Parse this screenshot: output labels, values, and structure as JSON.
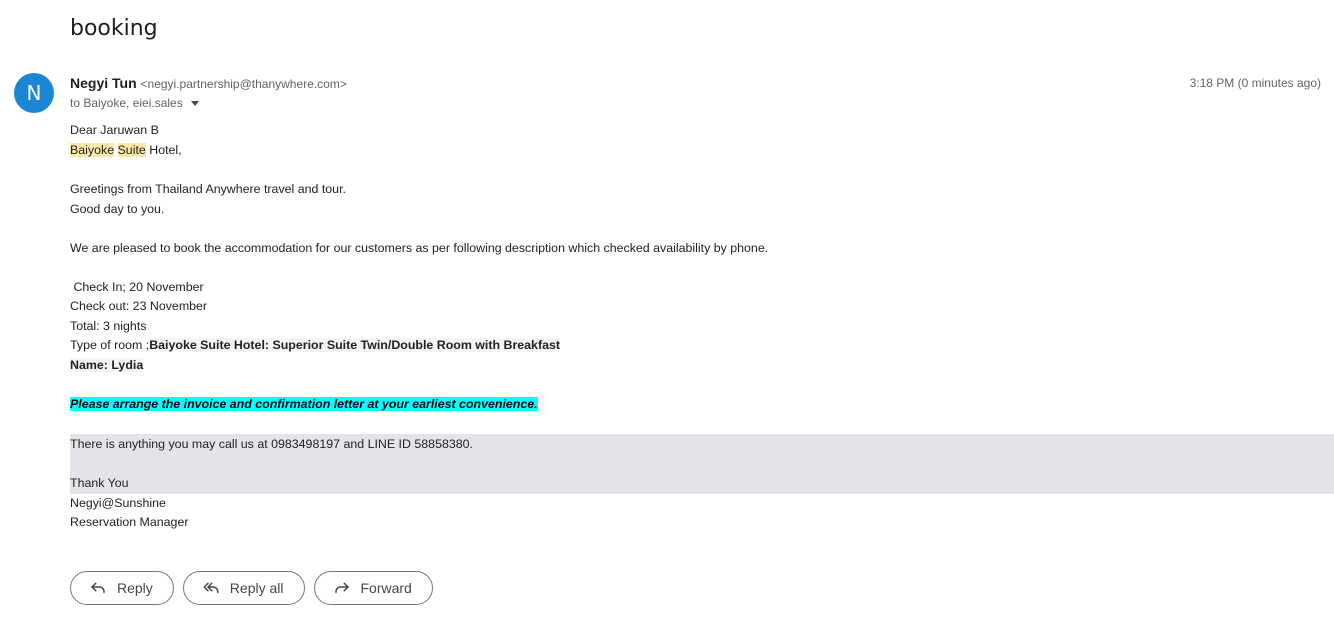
{
  "subject": "booking",
  "sender": {
    "avatar_letter": "N",
    "name": "Negyi Tun",
    "email": "<negyi.partnership@thanywhere.com>",
    "to": "to Baiyoke, eiei.sales",
    "timestamp": "3:18 PM (0 minutes ago)"
  },
  "body": {
    "greeting": "Dear Jaruwan B",
    "hotel_word1": "Baiyoke",
    "hotel_word2": "Suite",
    "hotel_rest": "Hotel,",
    "greetings_line": "Greetings from Thailand Anywhere travel and tour.",
    "good_day": "Good day to you.",
    "pleased_line": "We are pleased to book the accommodation for our customers as per following description which checked availability by phone.",
    "check_in": " Check In; 20 November",
    "check_out": "Check out: 23 November",
    "total": "Total: 3 nights",
    "room_type_label": "Type of room ;",
    "room_type_value": "Baiyoke Suite Hotel: Superior Suite Twin/Double Room with Breakfast",
    "name_line": "Name: Lydia",
    "arrange_line": "Please arrange the invoice and confirmation letter at your earliest convenience.",
    "contact_line": "There is anything you may call us at 0983498197 and LINE ID 58858380.",
    "thank_you": "Thank You",
    "signature_name": "Negyi@Sunshine",
    "signature_title": "Reservation Manager"
  },
  "actions": {
    "reply": "Reply",
    "reply_all": "Reply all",
    "forward": "Forward"
  },
  "colors": {
    "avatar": "#1b87d4",
    "highlight_yellow": "#fce8a6",
    "highlight_cyan": "#00ffff",
    "band_gray": "#e3e4e8"
  }
}
